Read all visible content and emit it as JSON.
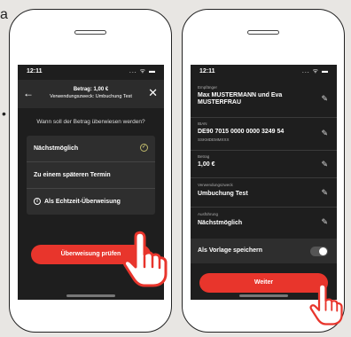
{
  "page": {
    "partial_text_top": "a",
    "bullet": "•"
  },
  "left_phone": {
    "time": "12:11",
    "signal": "...  ᯤ ▬",
    "header": {
      "title": "Betrag: 1,00 €",
      "subtitle": "Verwendungszweck: Umbuchung Test"
    },
    "question": "Wann soll der Betrag überwiesen werden?",
    "options": [
      {
        "label": "Nächstmöglich",
        "selected": true
      },
      {
        "label": "Zu einem späteren Termin",
        "selected": false
      },
      {
        "label": "Als Echtzeit-Überweisung",
        "selected": false
      }
    ],
    "button": "Überweisung prüfen"
  },
  "right_phone": {
    "time": "12:11",
    "signal": "...  ᯤ ▬",
    "fields": [
      {
        "label": "Empfänger",
        "value": "Max MUSTERMANN und Eva MUSTERFRAU",
        "sub": ""
      },
      {
        "label": "IBAN",
        "value": "DE90 7015 0000 0000 3249 54",
        "sub": "SSKMDEMMXXX"
      },
      {
        "label": "Betrag",
        "value": "1,00 €",
        "sub": ""
      },
      {
        "label": "Verwendungszweck",
        "value": "Umbuchung Test",
        "sub": ""
      },
      {
        "label": "Ausführung",
        "value": "Nächstmöglich",
        "sub": ""
      }
    ],
    "template_label": "Als Vorlage speichern",
    "button": "Weiter"
  },
  "colors": {
    "accent_red": "#e8352c",
    "screen_bg": "#1e1e1e"
  }
}
